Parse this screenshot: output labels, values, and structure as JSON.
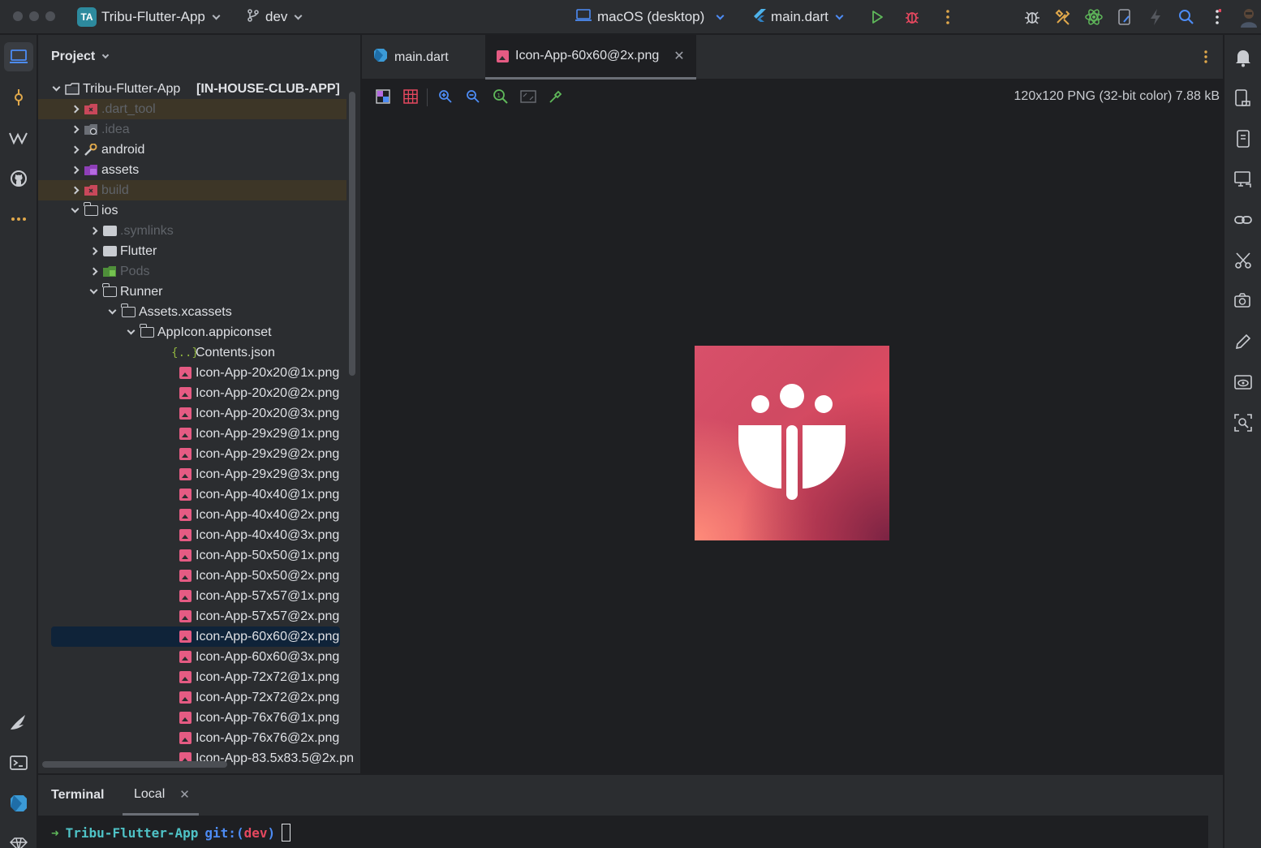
{
  "titlebar": {
    "project_badge": "TA",
    "project_name": "Tribu-Flutter-App",
    "branch": "dev",
    "device": "macOS (desktop)",
    "run_config": "main.dart"
  },
  "project_panel": {
    "title": "Project",
    "tree": [
      {
        "label": "Tribu-Flutter-App",
        "suffix": "[IN-HOUSE-CLUB-APP]",
        "depth": 0,
        "state": "open",
        "icon": "module-folder-icon"
      },
      {
        "label": ".dart_tool",
        "depth": 1,
        "state": "closed",
        "icon": "excluded-folder-icon",
        "dim": true,
        "excluded": true
      },
      {
        "label": ".idea",
        "depth": 1,
        "state": "closed",
        "icon": "idea-folder-icon",
        "dim": true
      },
      {
        "label": "android",
        "depth": 1,
        "state": "closed",
        "icon": "wrench-folder-icon"
      },
      {
        "label": "assets",
        "depth": 1,
        "state": "closed",
        "icon": "resource-folder-icon"
      },
      {
        "label": "build",
        "depth": 1,
        "state": "closed",
        "icon": "excluded-folder-icon",
        "dim": true,
        "excluded": true
      },
      {
        "label": "ios",
        "depth": 1,
        "state": "open",
        "icon": "folder-icon"
      },
      {
        "label": ".symlinks",
        "depth": 2,
        "state": "closed",
        "icon": "folder-filled-icon",
        "dim": true
      },
      {
        "label": "Flutter",
        "depth": 2,
        "state": "closed",
        "icon": "folder-filled-icon"
      },
      {
        "label": "Pods",
        "depth": 2,
        "state": "closed",
        "icon": "pods-folder-icon",
        "dim": true
      },
      {
        "label": "Runner",
        "depth": 2,
        "state": "open",
        "icon": "folder-icon"
      },
      {
        "label": "Assets.xcassets",
        "depth": 3,
        "state": "open",
        "icon": "folder-icon"
      },
      {
        "label": "AppIcon.appiconset",
        "depth": 4,
        "state": "open",
        "icon": "folder-icon"
      },
      {
        "label": "Contents.json",
        "depth": 5,
        "state": "leaf",
        "icon": "json-file-icon"
      },
      {
        "label": "Icon-App-20x20@1x.png",
        "depth": 5,
        "state": "leaf",
        "icon": "image-file-icon"
      },
      {
        "label": "Icon-App-20x20@2x.png",
        "depth": 5,
        "state": "leaf",
        "icon": "image-file-icon"
      },
      {
        "label": "Icon-App-20x20@3x.png",
        "depth": 5,
        "state": "leaf",
        "icon": "image-file-icon"
      },
      {
        "label": "Icon-App-29x29@1x.png",
        "depth": 5,
        "state": "leaf",
        "icon": "image-file-icon"
      },
      {
        "label": "Icon-App-29x29@2x.png",
        "depth": 5,
        "state": "leaf",
        "icon": "image-file-icon"
      },
      {
        "label": "Icon-App-29x29@3x.png",
        "depth": 5,
        "state": "leaf",
        "icon": "image-file-icon"
      },
      {
        "label": "Icon-App-40x40@1x.png",
        "depth": 5,
        "state": "leaf",
        "icon": "image-file-icon"
      },
      {
        "label": "Icon-App-40x40@2x.png",
        "depth": 5,
        "state": "leaf",
        "icon": "image-file-icon"
      },
      {
        "label": "Icon-App-40x40@3x.png",
        "depth": 5,
        "state": "leaf",
        "icon": "image-file-icon"
      },
      {
        "label": "Icon-App-50x50@1x.png",
        "depth": 5,
        "state": "leaf",
        "icon": "image-file-icon"
      },
      {
        "label": "Icon-App-50x50@2x.png",
        "depth": 5,
        "state": "leaf",
        "icon": "image-file-icon"
      },
      {
        "label": "Icon-App-57x57@1x.png",
        "depth": 5,
        "state": "leaf",
        "icon": "image-file-icon"
      },
      {
        "label": "Icon-App-57x57@2x.png",
        "depth": 5,
        "state": "leaf",
        "icon": "image-file-icon"
      },
      {
        "label": "Icon-App-60x60@2x.png",
        "depth": 5,
        "state": "leaf",
        "icon": "image-file-icon",
        "selected": true
      },
      {
        "label": "Icon-App-60x60@3x.png",
        "depth": 5,
        "state": "leaf",
        "icon": "image-file-icon"
      },
      {
        "label": "Icon-App-72x72@1x.png",
        "depth": 5,
        "state": "leaf",
        "icon": "image-file-icon"
      },
      {
        "label": "Icon-App-72x72@2x.png",
        "depth": 5,
        "state": "leaf",
        "icon": "image-file-icon"
      },
      {
        "label": "Icon-App-76x76@1x.png",
        "depth": 5,
        "state": "leaf",
        "icon": "image-file-icon"
      },
      {
        "label": "Icon-App-76x76@2x.png",
        "depth": 5,
        "state": "leaf",
        "icon": "image-file-icon"
      },
      {
        "label": "Icon-App-83.5x83.5@2x.pn",
        "depth": 5,
        "state": "leaf",
        "icon": "image-file-icon"
      }
    ]
  },
  "editor": {
    "tabs": [
      {
        "label": "main.dart",
        "icon": "dart-file-icon"
      },
      {
        "label": "Icon-App-60x60@2x.png",
        "icon": "image-file-icon",
        "active": true,
        "closable": true
      }
    ],
    "image_info": "120x120 PNG (32-bit color) 7.88 kB"
  },
  "terminal": {
    "title": "Terminal",
    "tab_label": "Local",
    "prompt_arrow": "➜",
    "prompt_dir": "Tribu-Flutter-App",
    "prompt_git": "git:(",
    "prompt_branch": "dev",
    "prompt_close": ")"
  },
  "colors": {
    "background": "#1e1f22",
    "panel": "#2b2d30",
    "selection": "#0f2339",
    "accent_blue": "#4d8cf5",
    "image_icon": "#e55b83"
  }
}
